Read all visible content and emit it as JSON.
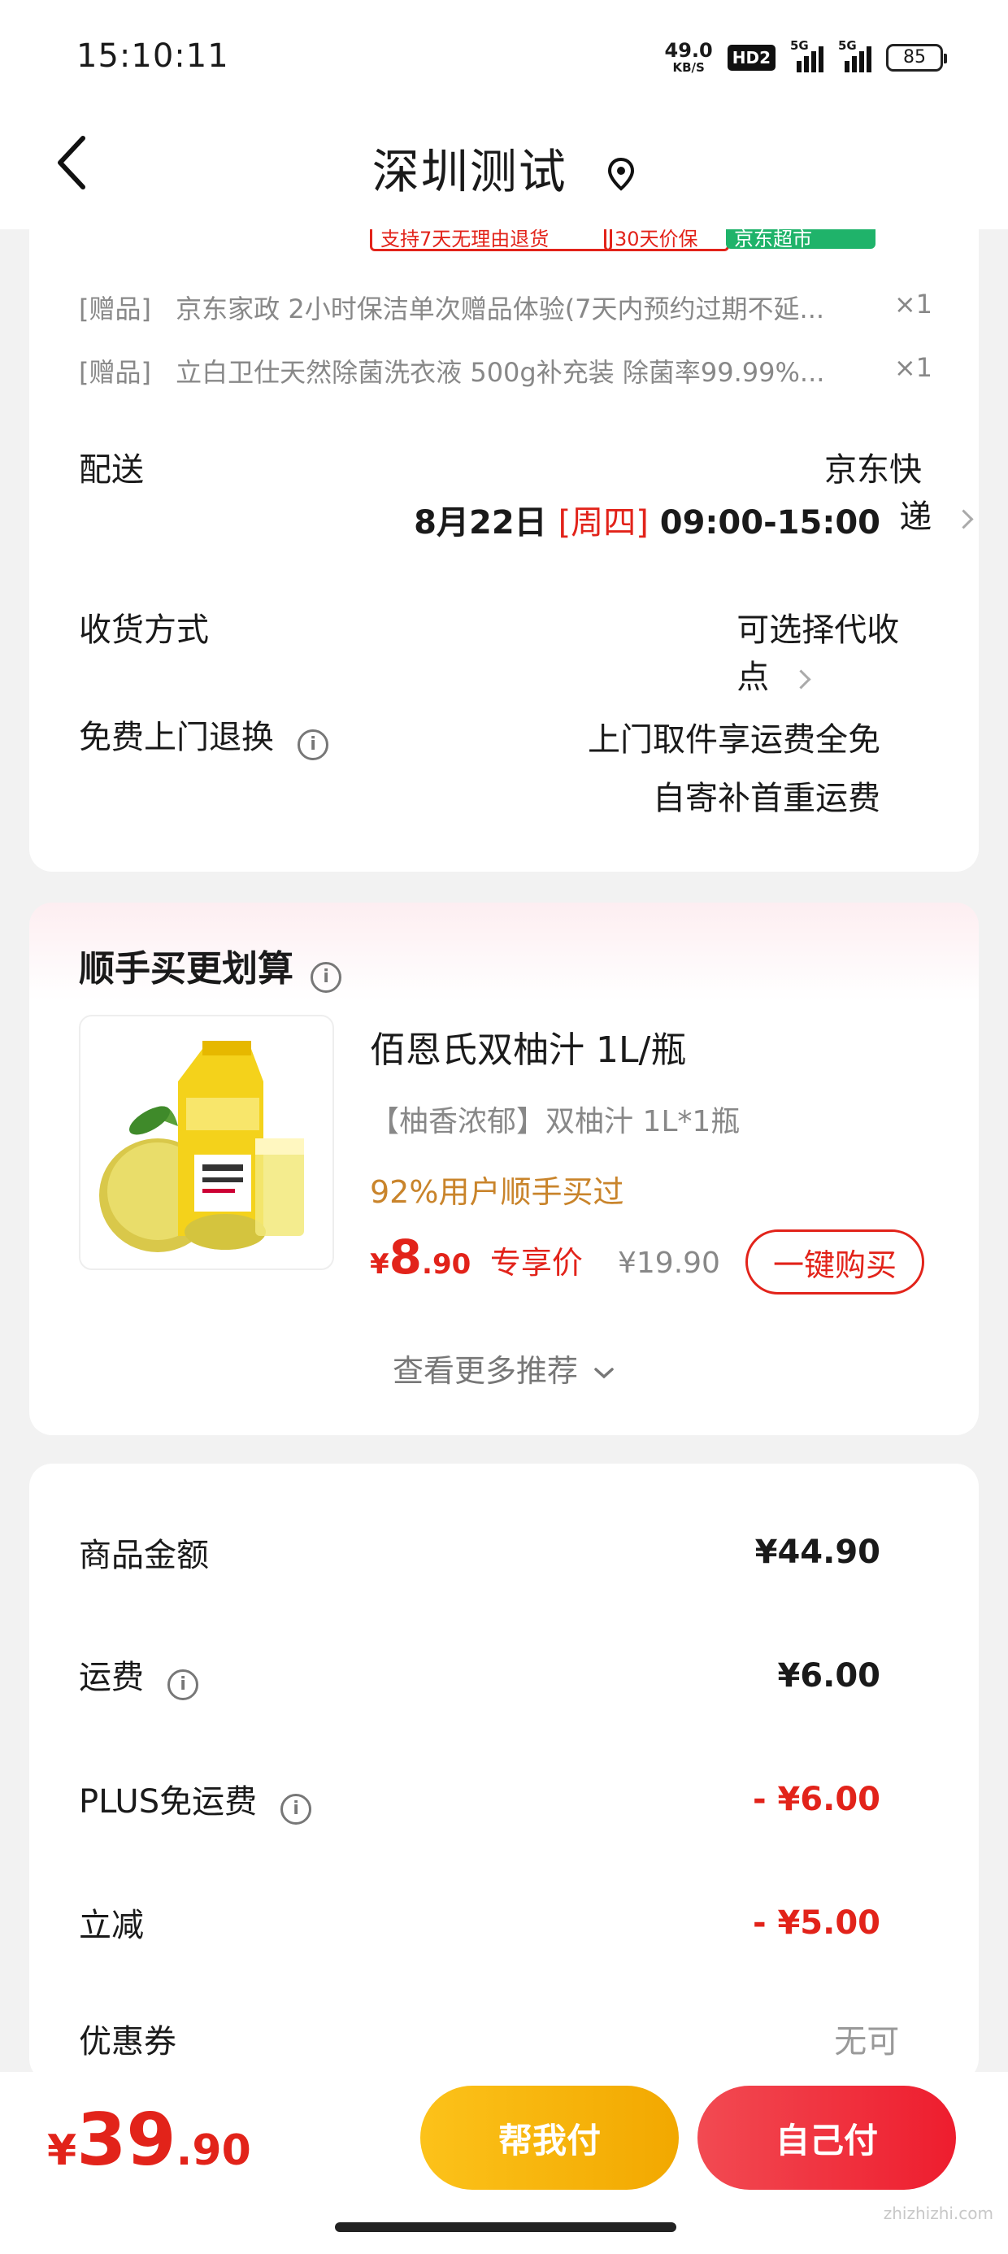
{
  "status": {
    "time": "15:10:11",
    "net_speed": "49.0",
    "net_unit": "KB/S",
    "hd": "HD2",
    "sig1": "5G",
    "sig2": "5G",
    "battery": "85"
  },
  "nav": {
    "title": "深圳测试"
  },
  "tags": [
    "支持7天无理由退货",
    "30天价保",
    "京东超市"
  ],
  "gifts": [
    {
      "tag": "[赠品]",
      "text": "京东家政 2小时保洁单次赠品体验(7天内预约过期不延...",
      "qty": "×1"
    },
    {
      "tag": "[赠品]",
      "text": "立白卫仕天然除菌洗衣液 500g补充装 除菌率99.99%...",
      "qty": "×1"
    }
  ],
  "delivery": {
    "label": "配送",
    "carrier": "京东快递",
    "date": "8月22日",
    "weekday": "[周四]",
    "window": "09:00-15:00"
  },
  "receive": {
    "label": "收货方式",
    "value": "可选择代收点"
  },
  "return_service": {
    "label": "免费上门退换",
    "line1": "上门取件享运费全免",
    "line2": "自寄补首重运费"
  },
  "upsell": {
    "title": "顺手买更划算",
    "product_name": "佰恩氏双柚汁 1L/瓶",
    "product_sub": "【柚香浓郁】双柚汁 1L*1瓶",
    "bought": "92%用户顺手买过",
    "price_symbol": "¥",
    "price_int": "8",
    "price_dec": ".90",
    "exclusive": "专享价",
    "orig_price": "¥19.90",
    "buy_button": "一键购买",
    "more": "查看更多推荐"
  },
  "summary": [
    {
      "label": "商品金额",
      "value": "¥44.90",
      "info": false,
      "red": false
    },
    {
      "label": "运费",
      "value": "¥6.00",
      "info": true,
      "red": false
    },
    {
      "label": "PLUS免运费",
      "value": "- ¥6.00",
      "info": true,
      "red": true
    },
    {
      "label": "立减",
      "value": "- ¥5.00",
      "info": false,
      "red": true
    }
  ],
  "coupon": {
    "label": "优惠券",
    "value": "无可用"
  },
  "total": {
    "symbol": "¥",
    "int": "39",
    "dec": ".90"
  },
  "buttons": {
    "help_pay": "帮我付",
    "self_pay": "自己付"
  },
  "watermark": {
    "text": "zhizhizhi.com"
  },
  "colors": {
    "accent_red": "#e2231a",
    "gold": "#c9842b",
    "help_pay": "#f6b40c",
    "self_pay": "#f2303c",
    "jd_green": "#1fb36a"
  }
}
